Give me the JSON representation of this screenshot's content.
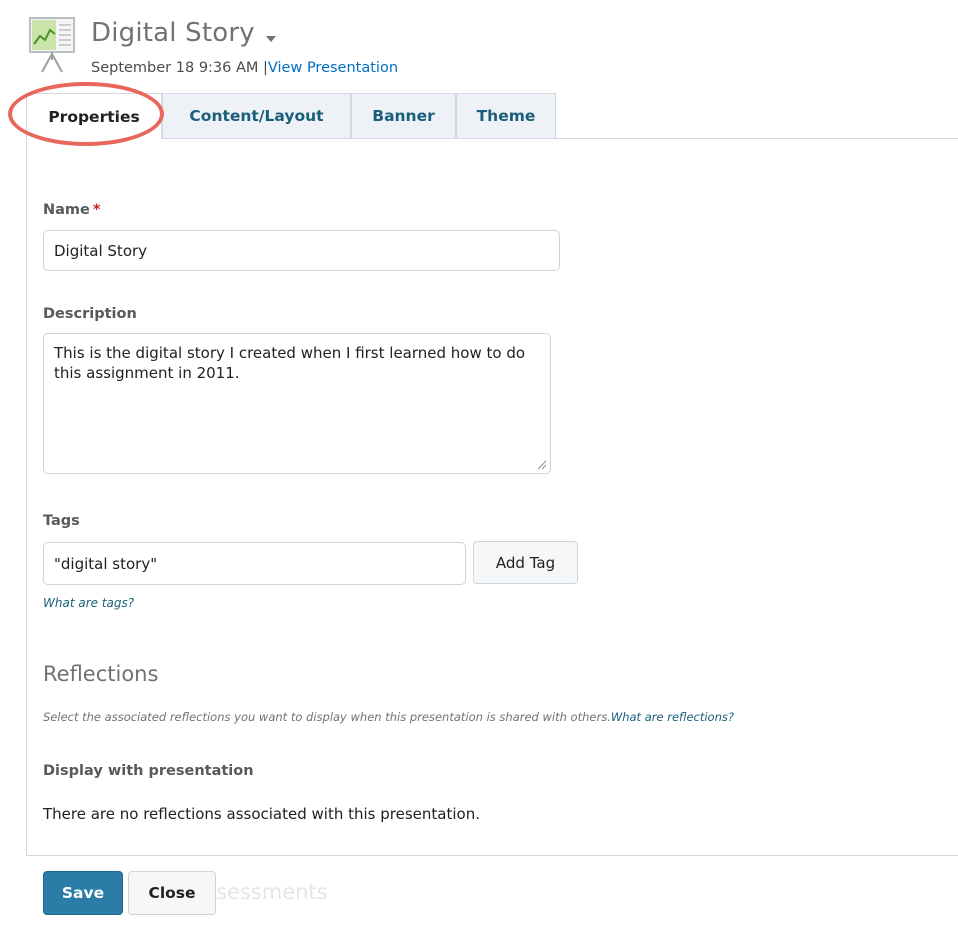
{
  "header": {
    "title": "Digital Story",
    "date": "September 18 9:36 AM",
    "separator": "|",
    "view_link": "View Presentation"
  },
  "tabs": [
    {
      "label": "Properties",
      "active": true
    },
    {
      "label": "Content/Layout",
      "active": false
    },
    {
      "label": "Banner",
      "active": false
    },
    {
      "label": "Theme",
      "active": false
    }
  ],
  "form": {
    "name": {
      "label": "Name",
      "required_mark": "*",
      "value": "Digital Story"
    },
    "description": {
      "label": "Description",
      "value": "This is the digital story I created when I first learned how to do this assignment in 2011."
    },
    "tags": {
      "label": "Tags",
      "value": "\"digital story\"",
      "add_button": "Add Tag",
      "help_link": "What are tags?"
    }
  },
  "reflections": {
    "heading": "Reflections",
    "note": "Select the associated reflections you want to display when this presentation is shared with others.",
    "note_link": "What are reflections?",
    "display_label": "Display with presentation",
    "empty_message": "There are no reflections associated with this presentation."
  },
  "footer": {
    "save": "Save",
    "close": "Close",
    "faded_text": "sessments"
  },
  "colors": {
    "link": "#006fbf",
    "tab_text": "#1a5e7a",
    "primary_button": "#2b7da7",
    "highlight_ring": "#e8665a",
    "required": "#cd2026"
  },
  "icons": [
    "presentation-board-icon",
    "caret-down-icon",
    "resize-grip-icon"
  ]
}
